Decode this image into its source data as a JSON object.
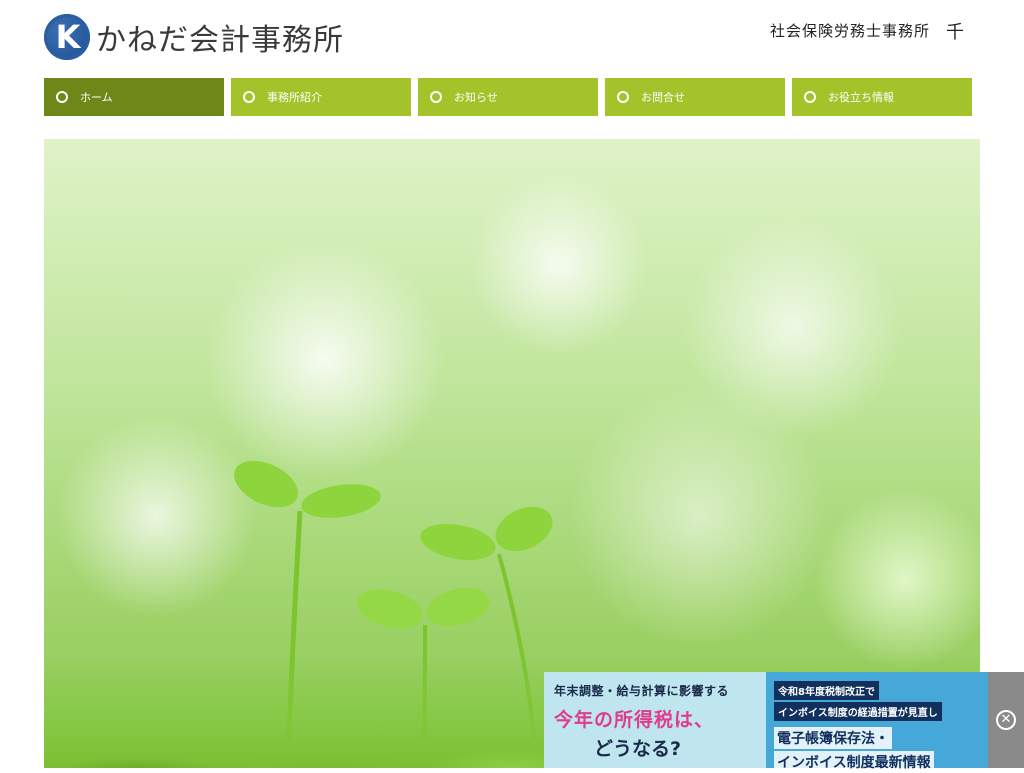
{
  "header": {
    "logo_letter": "K",
    "site_title": "かねだ会計事務所",
    "sub_office_text": "社会保険労務士事務所",
    "sub_office_mark": "千"
  },
  "nav": {
    "items": [
      {
        "label": "ホーム",
        "active": true
      },
      {
        "label": "事務所紹介",
        "active": false
      },
      {
        "label": "お知らせ",
        "active": false
      },
      {
        "label": "お問合せ",
        "active": false
      },
      {
        "label": "お役立ち情報",
        "active": false
      }
    ]
  },
  "ad": {
    "left": {
      "line1": "年末調整・給与計算に影響する",
      "line2": "今年の所得税は、",
      "line3": "どうなる?"
    },
    "right": {
      "line1": "令和8年度税制改正で",
      "line2": "インボイス制度の経過措置が見直し",
      "line3": "電子帳簿保存法・",
      "line4": "インボイス制度最新情報"
    },
    "close_glyph": "✕"
  },
  "colors": {
    "nav_bg": "#a4c22a",
    "nav_active_bg": "#6e8718",
    "logo_blue": "#1d4e8f"
  }
}
